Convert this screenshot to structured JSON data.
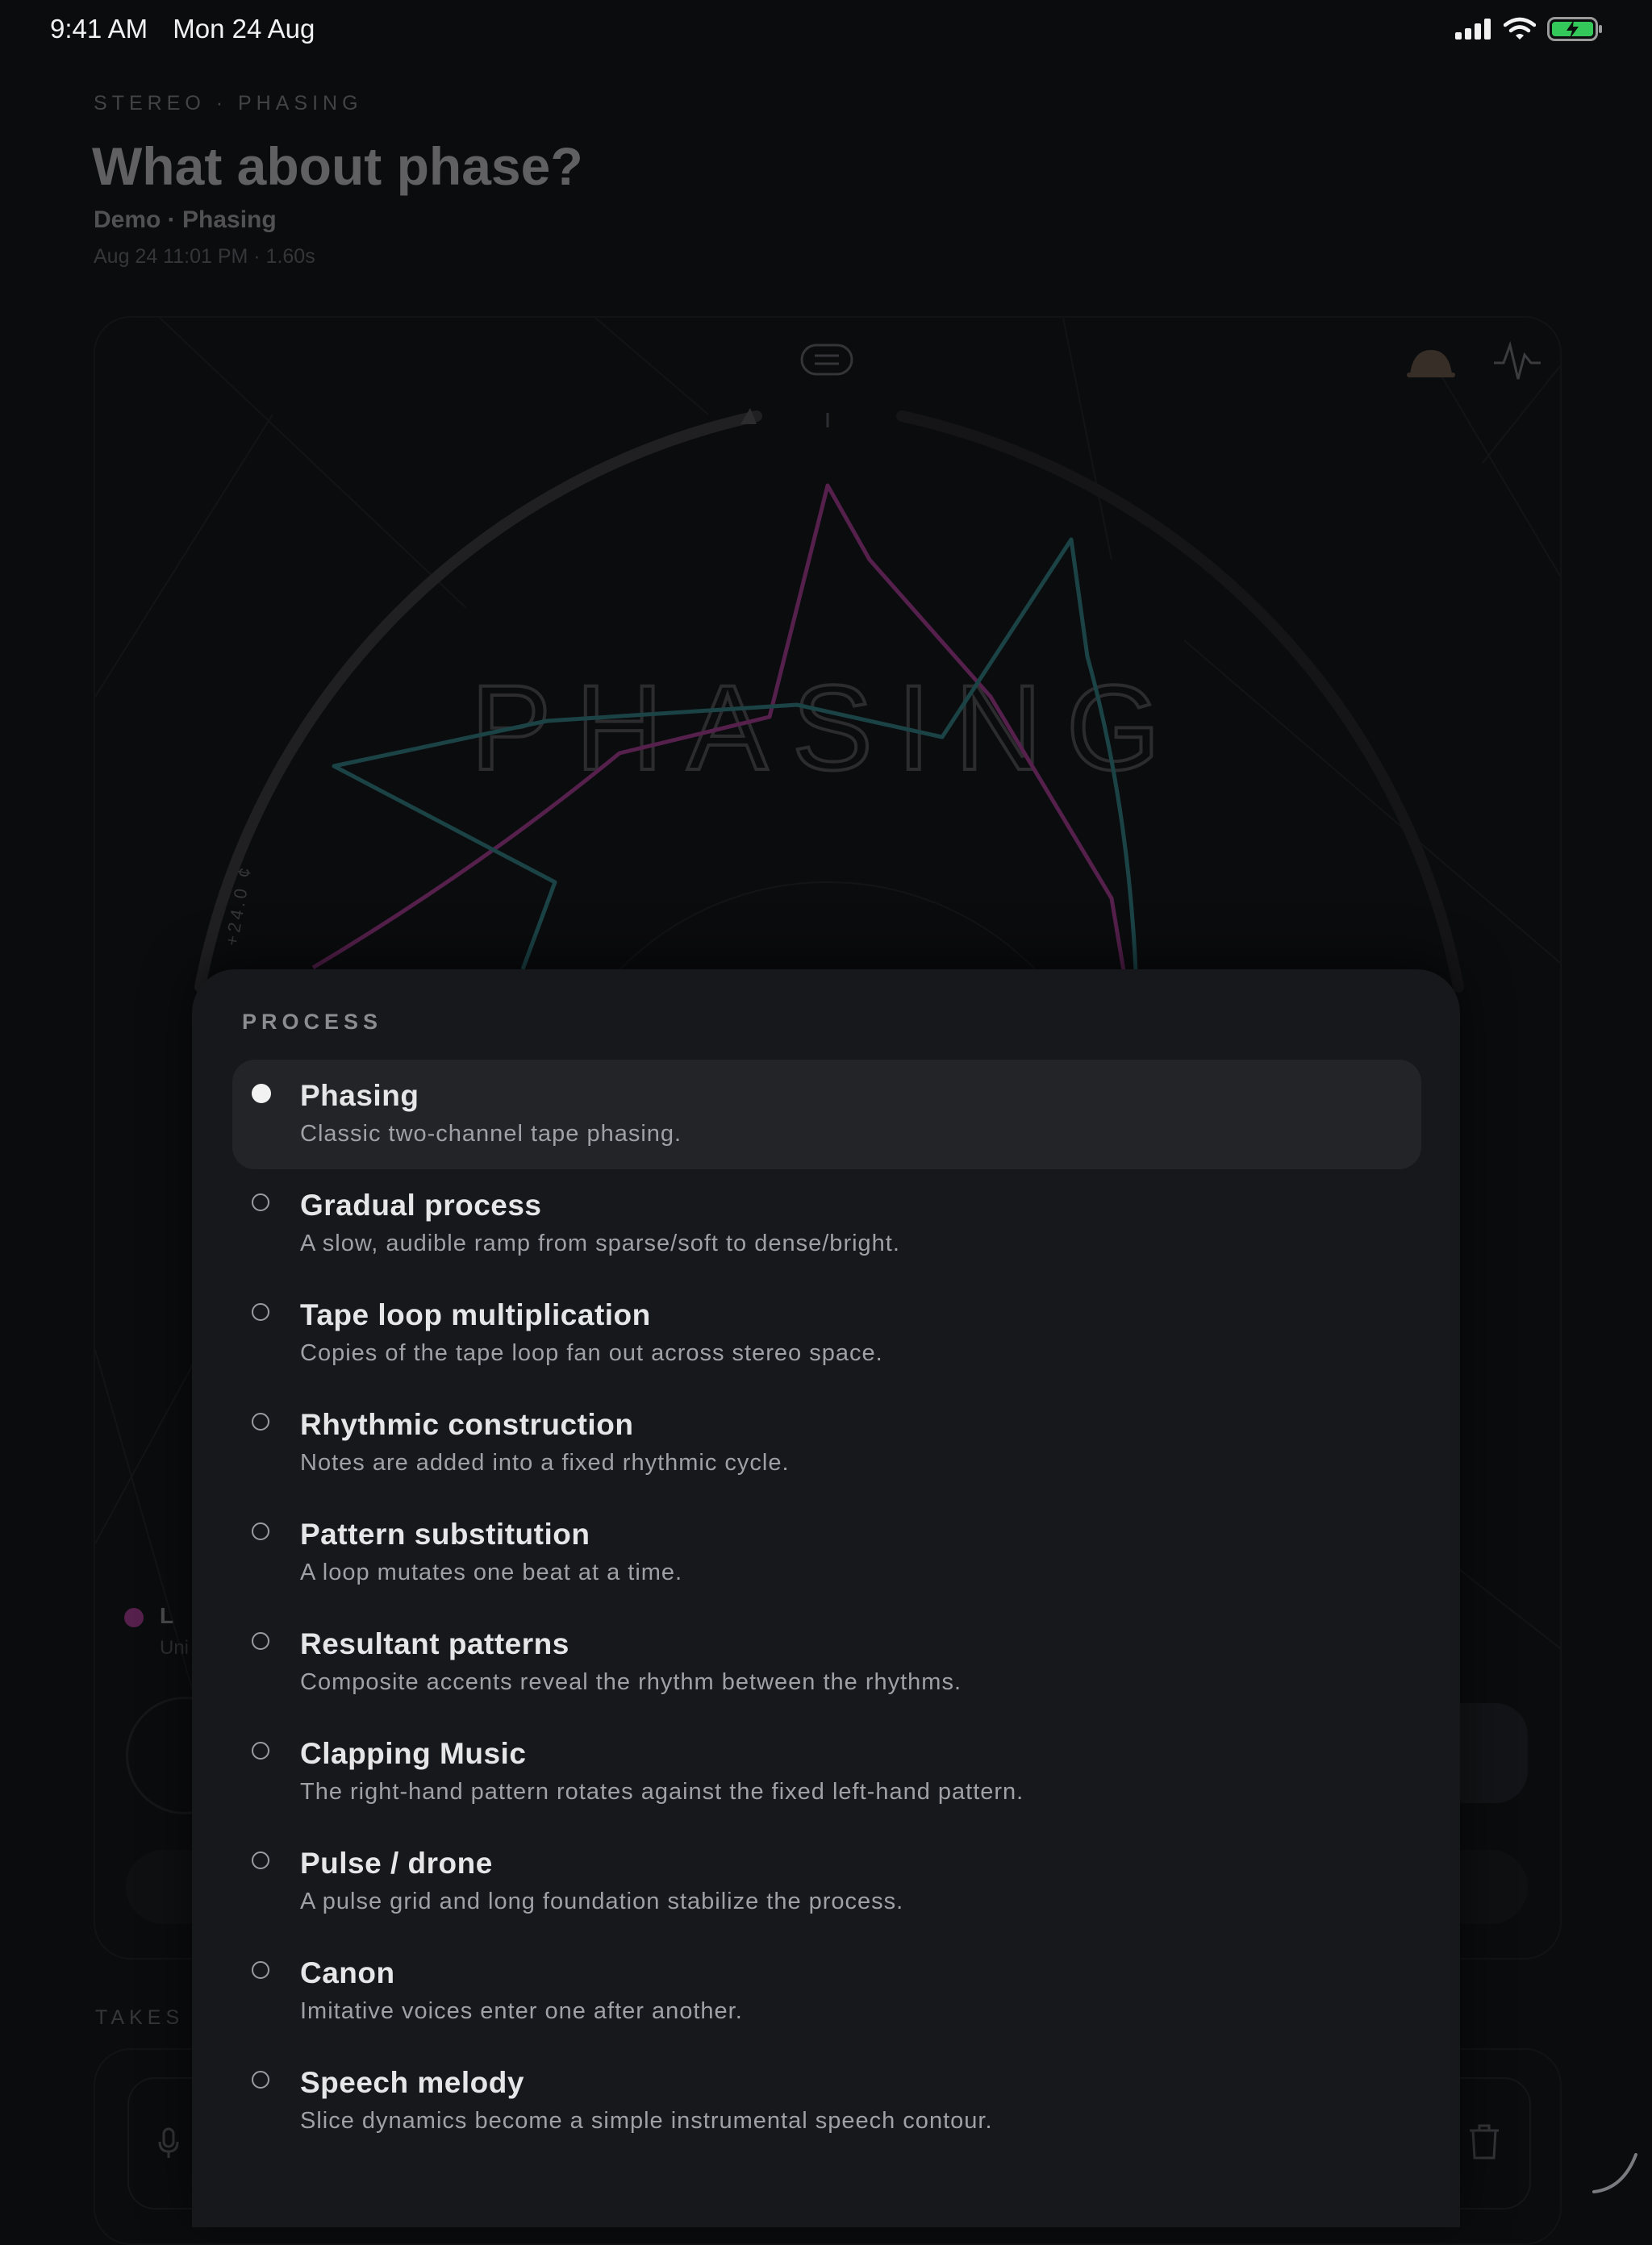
{
  "status_bar": {
    "time": "9:41 AM",
    "date": "Mon 24 Aug",
    "icons": [
      "signal-icon",
      "wifi-icon",
      "battery-charging-icon"
    ]
  },
  "header": {
    "eyebrow": "STEREO · PHASING",
    "title": "What about phase?",
    "subtitle": "Demo · Phasing",
    "meta": "Aug 24 11:01 PM · 1.60s"
  },
  "visual": {
    "arc_text": "PHASING",
    "pitch_label": "+24.0 ¢",
    "icons": [
      "menu-pill-icon",
      "bell-icon",
      "waveform-icon"
    ],
    "colors": {
      "left_channel": "#b03a9a",
      "right_channel": "#2f8a8e"
    }
  },
  "legend": {
    "label": "L",
    "sub": "Uni"
  },
  "takes": {
    "label": "TAKES"
  },
  "sheet": {
    "title": "PROCESS",
    "selected_index": 0,
    "options": [
      {
        "title": "Phasing",
        "desc": "Classic two-channel tape phasing."
      },
      {
        "title": "Gradual process",
        "desc": "A slow, audible ramp from sparse/soft to dense/bright."
      },
      {
        "title": "Tape loop multiplication",
        "desc": "Copies of the tape loop fan out across stereo space."
      },
      {
        "title": "Rhythmic construction",
        "desc": "Notes are added into a fixed rhythmic cycle."
      },
      {
        "title": "Pattern substitution",
        "desc": "A loop mutates one beat at a time."
      },
      {
        "title": "Resultant patterns",
        "desc": "Composite accents reveal the rhythm between the rhythms."
      },
      {
        "title": "Clapping Music",
        "desc": "The right-hand pattern rotates against the fixed left-hand pattern."
      },
      {
        "title": "Pulse / drone",
        "desc": "A pulse grid and long foundation stabilize the process."
      },
      {
        "title": "Canon",
        "desc": "Imitative voices enter one after another."
      },
      {
        "title": "Speech melody",
        "desc": "Slice dynamics become a simple instrumental speech contour."
      }
    ]
  }
}
